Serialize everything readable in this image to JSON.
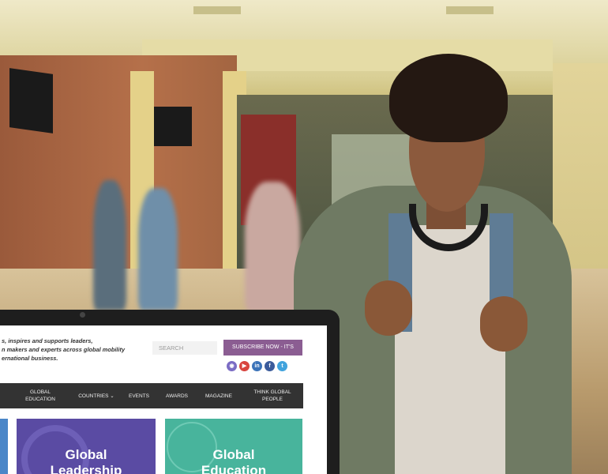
{
  "colors": {
    "subscribe_bg": "#8b5d92",
    "nav_bg": "#333333",
    "card_leadership": "#5a4ba3",
    "card_education": "#48b49c",
    "card_left_edge": "#4a86c8"
  },
  "website": {
    "intro_lines": [
      "s, inspires and supports leaders,",
      "n makers and experts across global mobility",
      "ernational business."
    ],
    "search_placeholder": "SEARCH",
    "subscribe_label": "SUBSCRIBE NOW - IT'S FREE!",
    "socials": [
      {
        "icon": "instagram-icon",
        "glyph": "◉",
        "color": "#7b6cc4"
      },
      {
        "icon": "youtube-icon",
        "glyph": "▶",
        "color": "#d8443e"
      },
      {
        "icon": "linkedin-icon",
        "glyph": "in",
        "color": "#3b73b9"
      },
      {
        "icon": "facebook-icon",
        "glyph": "f",
        "color": "#3b5b9b"
      },
      {
        "icon": "twitter-icon",
        "glyph": "t",
        "color": "#41a3dd"
      }
    ],
    "nav": [
      {
        "label": "GLOBAL EDUCATION"
      },
      {
        "label": "COUNTRIES ⌄"
      },
      {
        "label": "EVENTS"
      },
      {
        "label": "AWARDS"
      },
      {
        "label": "MAGAZINE"
      },
      {
        "label": "THINK GLOBAL PEOPLE"
      }
    ],
    "cards": [
      {
        "title_lines": [
          "Global",
          "Leadership"
        ]
      },
      {
        "title_lines": [
          "Global",
          "Education"
        ]
      }
    ]
  }
}
